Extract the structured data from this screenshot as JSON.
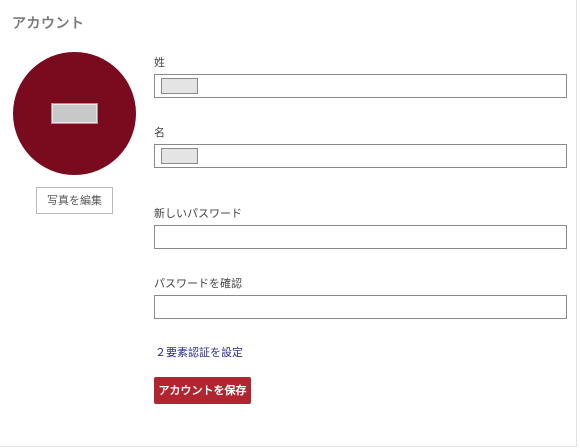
{
  "page": {
    "title": "アカウント"
  },
  "avatar": {
    "color": "#7a0a1e",
    "edit_photo_label": "写真を編集"
  },
  "form": {
    "last_name": {
      "label": "姓",
      "value": ""
    },
    "first_name": {
      "label": "名",
      "value": ""
    },
    "new_password": {
      "label": "新しいパスワード",
      "value": ""
    },
    "confirm_password": {
      "label": "パスワードを確認",
      "value": ""
    }
  },
  "two_factor": {
    "link_label": "２要素認証を設定"
  },
  "actions": {
    "save_label": "アカウントを保存",
    "save_color": "#b0252f"
  }
}
